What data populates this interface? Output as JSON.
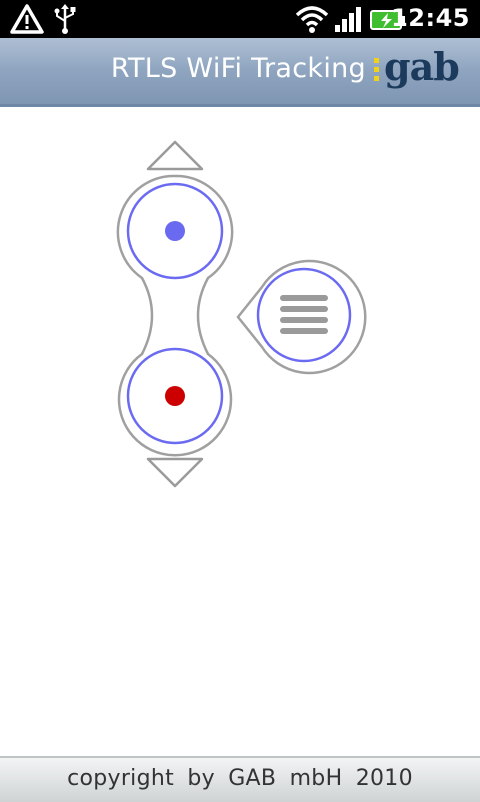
{
  "status_bar": {
    "time": "12:45",
    "icons": [
      "warning-icon",
      "usb-icon",
      "wifi-icon",
      "signal-icon",
      "battery-charging-icon"
    ]
  },
  "title_bar": {
    "title": "RTLS WiFi Tracking",
    "brand_logo": "gab"
  },
  "controls": {
    "up_arrow": "chevron-up-icon",
    "down_arrow": "chevron-down-icon",
    "top_indicator_color": "#6a6af0",
    "bottom_indicator_color": "#cc0000",
    "menu_icon": "menu-icon",
    "ring_color": "#6b6bf2",
    "outline_color": "#9a9a9a"
  },
  "footer": {
    "text": "copyright by GAB mbH 2010"
  }
}
